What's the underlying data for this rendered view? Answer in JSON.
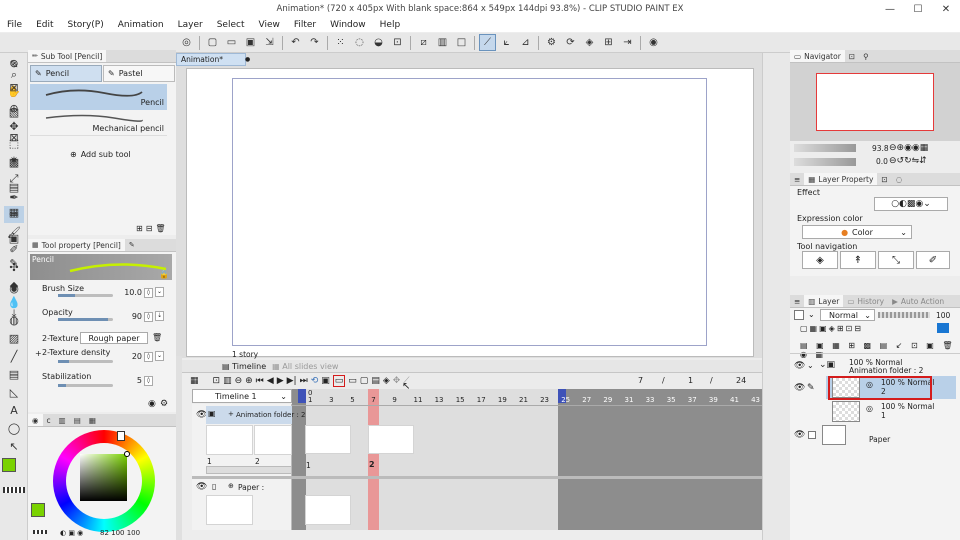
{
  "window": {
    "title": "Animation* (720 x 405px With blank space:864 x 549px 144dpi 93.8%) - CLIP STUDIO PAINT EX",
    "min": "—",
    "max": "☐",
    "close": "✕"
  },
  "menu": [
    "File",
    "Edit",
    "Story(P)",
    "Animation",
    "Layer",
    "Select",
    "View",
    "Filter",
    "Window",
    "Help"
  ],
  "sub_tool": {
    "tab": "Sub Tool [Pencil]",
    "tabs": [
      "Pencil",
      "Pastel"
    ],
    "items": [
      "Pencil",
      "Mechanical pencil"
    ],
    "add_label": "Add sub tool"
  },
  "tool_property": {
    "tab": "Tool property [Pencil]",
    "preview_label": "Pencil",
    "brush_size": {
      "label": "Brush Size",
      "value": "10.0",
      "level": 0.3
    },
    "opacity": {
      "label": "Opacity",
      "value": "90",
      "level": 0.9
    },
    "texture": {
      "label": "2-Texture",
      "value": "Rough paper"
    },
    "texture_density": {
      "label": "2-Texture density",
      "value": "20",
      "level": 0.2
    },
    "stabilization": {
      "label": "Stabilization",
      "value": "5",
      "level": 0.15
    }
  },
  "color": {
    "current": "#7ad200",
    "secondary": "#ffffff",
    "readout": "82  100  100"
  },
  "document": {
    "tab": "Animation*"
  },
  "timeline": {
    "tab_timeline": "Timeline",
    "tab_all_slides": "All slides view",
    "name": "Timeline 1",
    "story_label": "1 story",
    "frame_current": "7",
    "frame_start": "1",
    "frame_end": "24",
    "ruler_top": "0",
    "ruler": [
      "1",
      "3",
      "5",
      "7",
      "9",
      "11",
      "13",
      "15",
      "17",
      "19",
      "21",
      "23",
      "25",
      "27",
      "29",
      "31",
      "33",
      "35",
      "37",
      "39",
      "41",
      "43"
    ],
    "tracks": [
      {
        "name": "Animation folder : 2",
        "cells": [
          "1",
          "2"
        ],
        "markers": [
          "1",
          "2"
        ]
      },
      {
        "name": "Paper :"
      }
    ]
  },
  "navigator": {
    "tab": "Navigator",
    "zoom": "93.8",
    "angle": "0.0"
  },
  "layer_property": {
    "tab": "Layer Property",
    "effect": "Effect",
    "expression_color": "Expression color",
    "color_mode": "Color",
    "tool_navigation": "Tool navigation"
  },
  "layer_panel": {
    "tabs": [
      "Layer",
      "History",
      "Auto Action"
    ],
    "blend_mode": "Normal",
    "opacity": "100",
    "folder": {
      "line1": "100 % Normal",
      "line2": "Animation folder : 2"
    },
    "layers": [
      {
        "line1": "100 % Normal",
        "line2": "2"
      },
      {
        "line1": "100 % Normal",
        "line2": "1"
      }
    ],
    "paper": "Paper"
  }
}
